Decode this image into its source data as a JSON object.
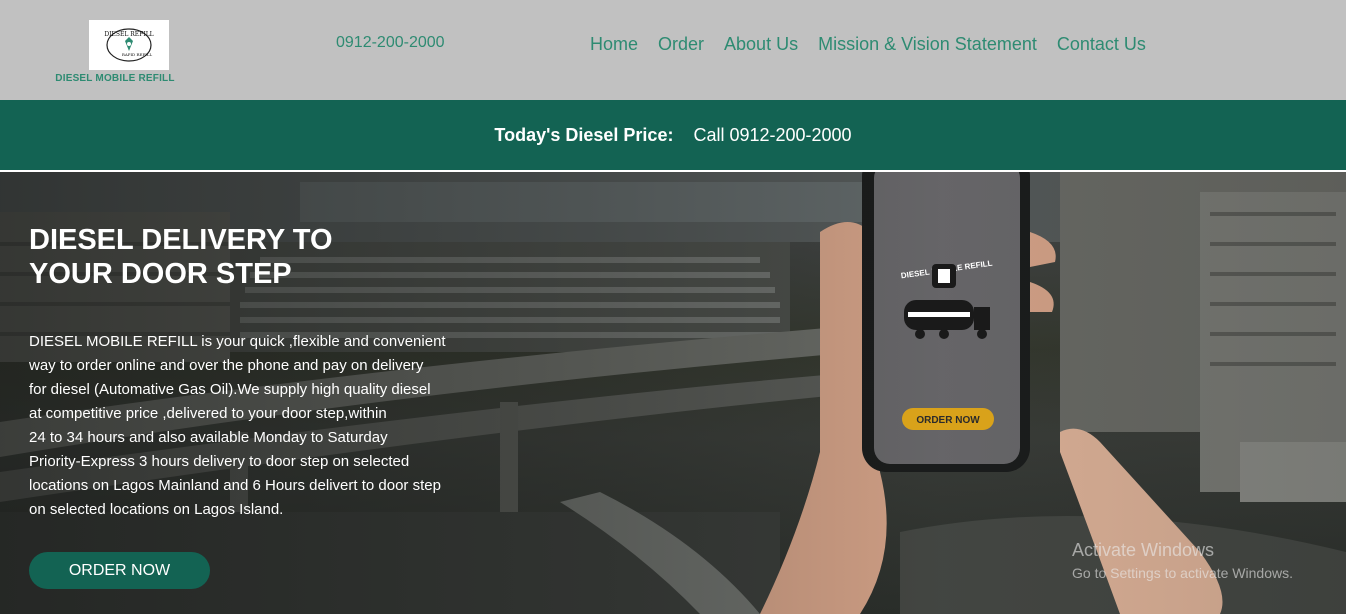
{
  "header": {
    "logo_caption": "DIESEL MOBILE REFILL",
    "logo_text_top": "DIESEL REFILL",
    "logo_text_bottom": "RAPID REFILL",
    "phone": "0912-200-2000",
    "nav": [
      {
        "label": "Home"
      },
      {
        "label": "Order"
      },
      {
        "label": "About Us"
      },
      {
        "label": "Mission & Vision Statement"
      },
      {
        "label": "Contact Us"
      }
    ]
  },
  "price_bar": {
    "label": "Today's Diesel Price:",
    "value": "Call 0912-200-2000"
  },
  "hero": {
    "title_line1": "DIESEL DELIVERY TO",
    "title_line2": "YOUR DOOR STEP",
    "description_lines": [
      "DIESEL MOBILE REFILL is your quick ,flexible and convenient",
      "way to order online and over the phone and pay on delivery",
      "for diesel (Automative Gas Oil).We supply high quality diesel",
      "at competitive price ,delivered to your door step,within",
      "24 to 34 hours and also available Monday to Saturday",
      "Priority-Express 3 hours delivery to door step on selected",
      "locations on Lagos Mainland and 6 Hours delivert to door step",
      "on selected locations on Lagos Island."
    ],
    "order_button": "ORDER NOW",
    "phone_screen": {
      "brand": "DIESEL MOBILE REFILL",
      "button": "ORDER NOW"
    }
  },
  "watermark": {
    "title": "Activate Windows",
    "subtitle": "Go to Settings to activate Windows."
  },
  "colors": {
    "brand_green": "#136353",
    "nav_text": "#2e8b72",
    "header_bg": "#c1c1c1",
    "phone_button": "#d9a21a"
  }
}
